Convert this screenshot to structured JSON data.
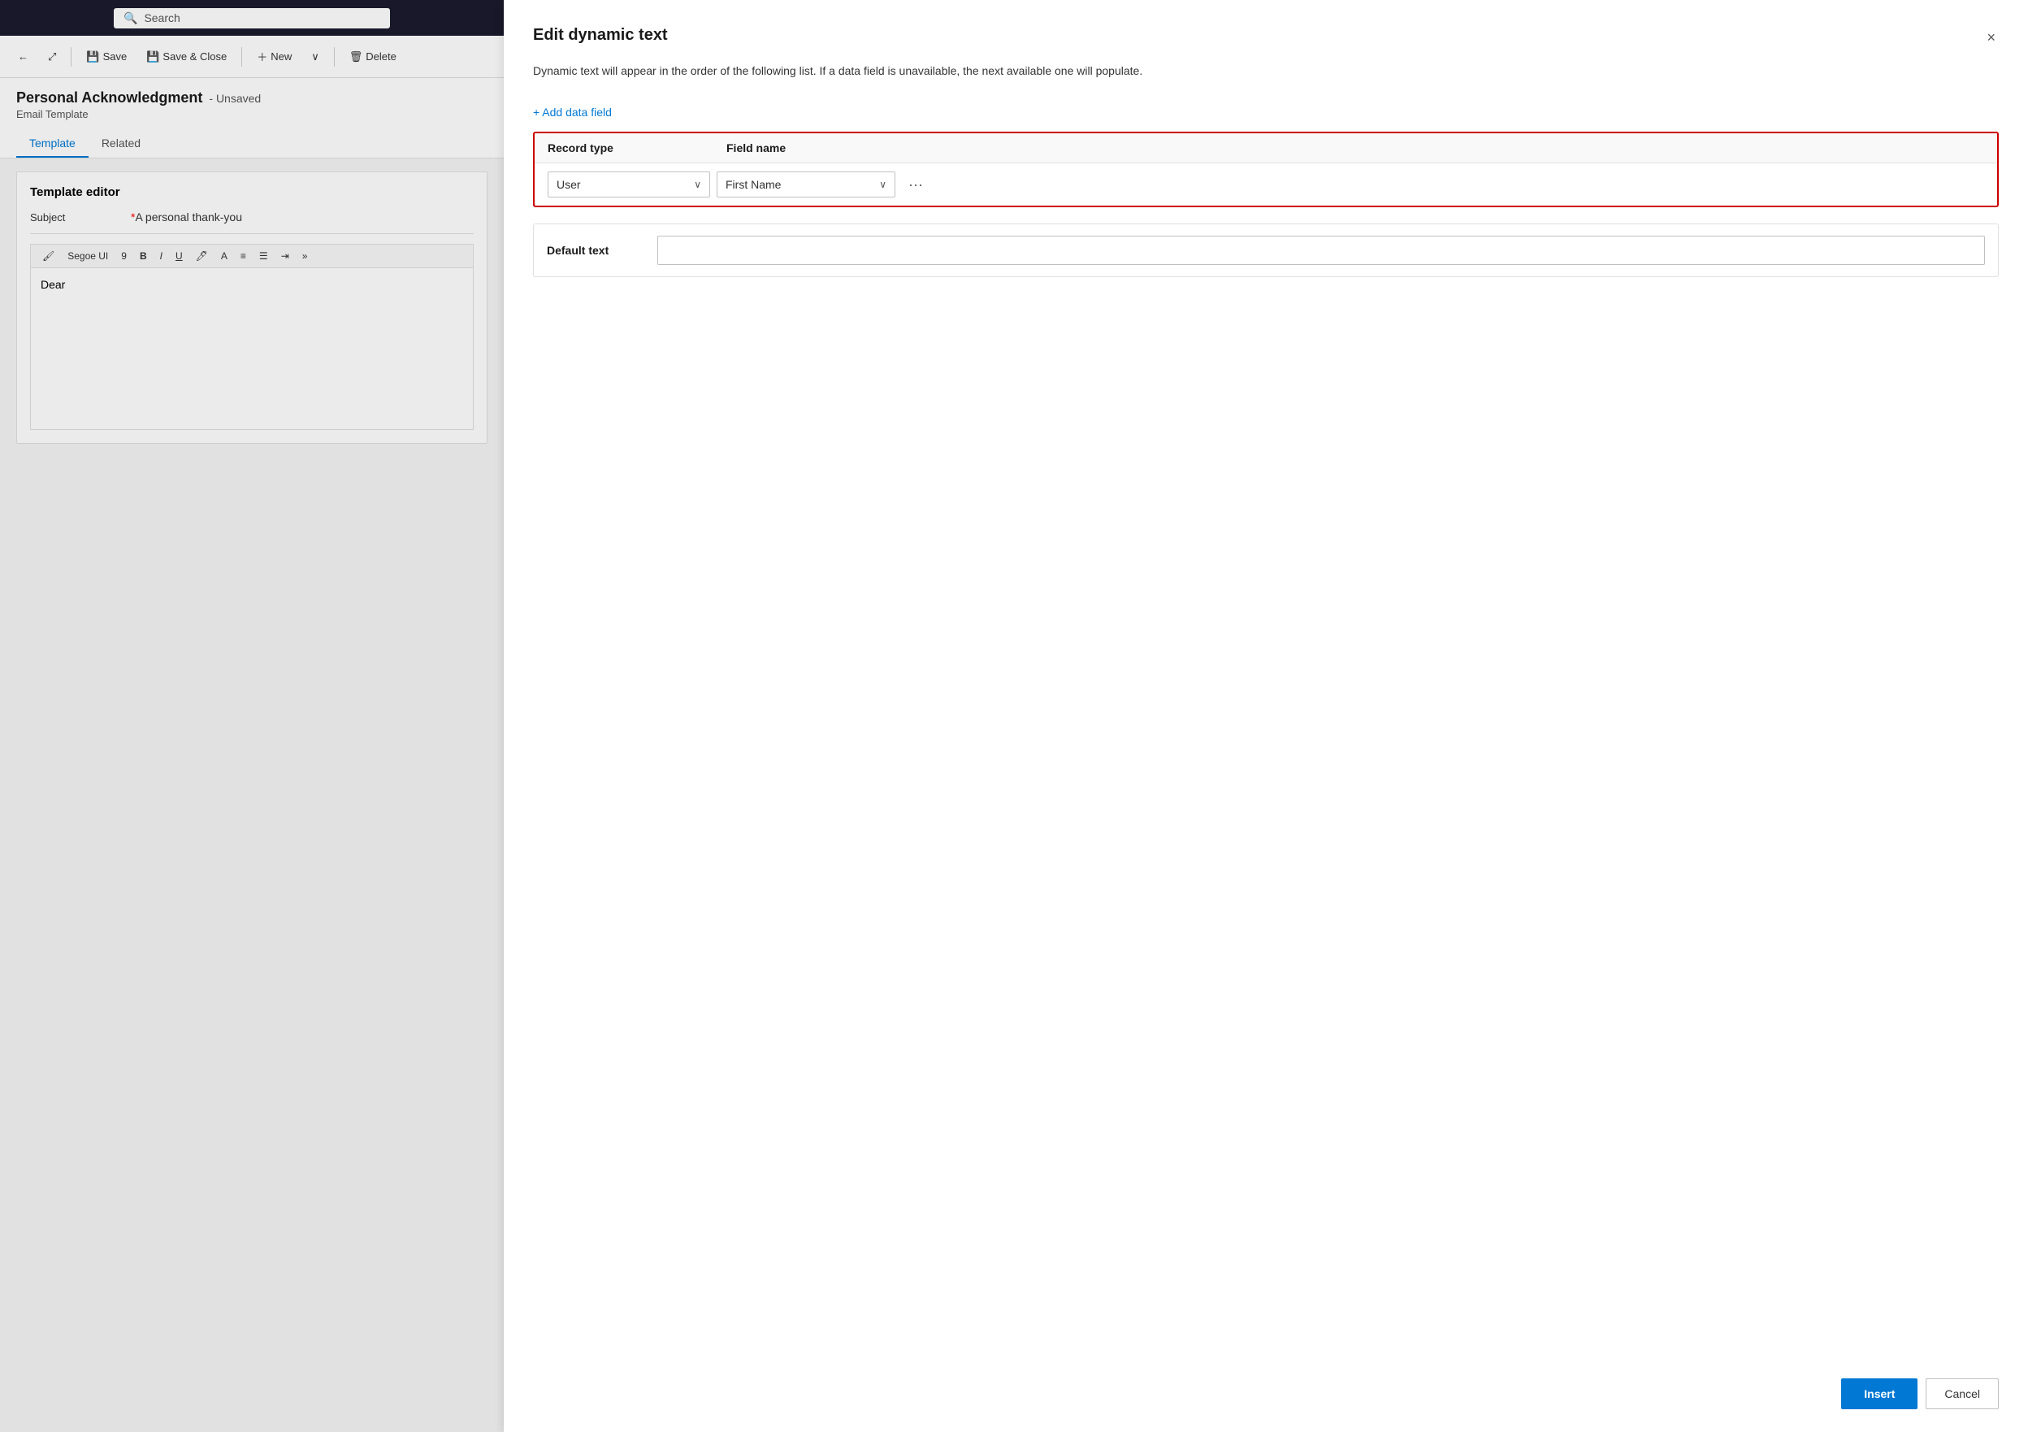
{
  "topbar": {
    "search_placeholder": "Search"
  },
  "toolbar": {
    "back_label": "",
    "share_label": "",
    "save_label": "Save",
    "save_close_label": "Save & Close",
    "new_label": "New",
    "delete_label": "Delete"
  },
  "page": {
    "title": "Personal Acknowledgment",
    "status": "- Unsaved",
    "subtitle": "Email Template",
    "tabs": [
      {
        "label": "Template",
        "active": true
      },
      {
        "label": "Related",
        "active": false
      }
    ]
  },
  "editor": {
    "title": "Template editor",
    "subject_label": "Subject",
    "subject_value": "A personal thank-you",
    "body_text": "Dear",
    "font_name": "Segoe UI",
    "font_size": "9"
  },
  "modal": {
    "title": "Edit dynamic text",
    "description": "Dynamic text will appear in the order of the following list. If a data field is unavailable, the next available one will populate.",
    "close_label": "×",
    "add_field_label": "+ Add data field",
    "table": {
      "col1": "Record type",
      "col2": "Field name",
      "row": {
        "record_type": "User",
        "field_name": "First Name"
      }
    },
    "default_text_label": "Default text",
    "insert_label": "Insert",
    "cancel_label": "Cancel"
  }
}
